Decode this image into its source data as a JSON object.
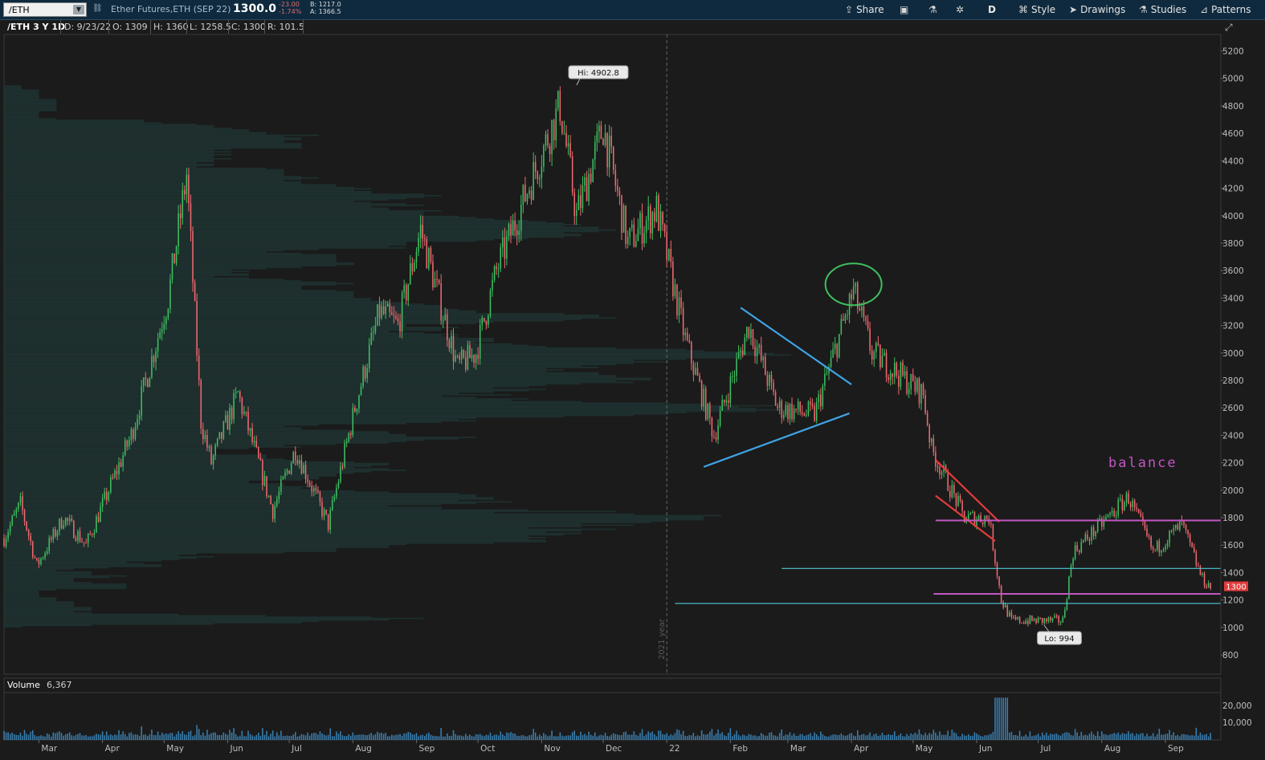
{
  "toolbar": {
    "symbol": "/ETH",
    "description": "Ether Futures,ETH (SEP 22)",
    "last_price": "1300.0",
    "change": "-23.00",
    "change_pct": "-1.74%",
    "bid": "B: 1217.0",
    "ask": "A: 1366.5",
    "share_label": "Share",
    "aggregation_label": "D",
    "style_label": "Style",
    "drawings_label": "Drawings",
    "studies_label": "Studies",
    "patterns_label": "Patterns"
  },
  "info_bar": {
    "title": "/ETH 3 Y 1D",
    "date": "D: 9/23/22",
    "open": "O: 1309",
    "high": "H: 1360",
    "low": "L: 1258.5",
    "close": "C: 1300",
    "range": "R: 101.5"
  },
  "volume_pane": {
    "label": "Volume",
    "value": "6,367",
    "ticks": [
      "20,000",
      "10,000"
    ]
  },
  "chart_data": {
    "type": "candlestick",
    "y_axis": {
      "ticks": [
        5200,
        5000,
        4800,
        4600,
        4400,
        4200,
        4000,
        3800,
        3600,
        3400,
        3200,
        3000,
        2800,
        2600,
        2400,
        2200,
        2000,
        1800,
        1600,
        1400,
        1200,
        1000,
        800
      ],
      "ylim": [
        660,
        5320
      ]
    },
    "x_axis": {
      "labels": [
        "Mar",
        "Apr",
        "May",
        "Jun",
        "Jul",
        "Aug",
        "Sep",
        "Oct",
        "Nov",
        "Dec",
        "22",
        "Feb",
        "Mar",
        "Apr",
        "May",
        "Jun",
        "Jul",
        "Aug",
        "Sep"
      ],
      "dates": [
        "2021-03-01",
        "2021-04-01",
        "2021-05-01",
        "2021-06-01",
        "2021-07-01",
        "2021-08-01",
        "2021-09-01",
        "2021-10-01",
        "2021-11-01",
        "2021-12-01",
        "2022-01-01",
        "2022-02-01",
        "2022-03-01",
        "2022-04-01",
        "2022-05-01",
        "2022-06-01",
        "2022-07-01",
        "2022-08-01",
        "2022-09-01"
      ],
      "range": [
        "2021-02-12",
        "2022-09-28"
      ]
    },
    "price_path": [
      [
        "2021-02-12",
        1650
      ],
      [
        "2021-02-20",
        1900
      ],
      [
        "2021-02-28",
        1450
      ],
      [
        "2021-03-13",
        1800
      ],
      [
        "2021-03-24",
        1600
      ],
      [
        "2021-04-15",
        2400
      ],
      [
        "2021-05-03",
        3400
      ],
      [
        "2021-05-12",
        4300
      ],
      [
        "2021-05-19",
        2500
      ],
      [
        "2021-05-24",
        2200
      ],
      [
        "2021-06-06",
        2700
      ],
      [
        "2021-06-23",
        1850
      ],
      [
        "2021-07-04",
        2300
      ],
      [
        "2021-07-20",
        1750
      ],
      [
        "2021-08-02",
        2600
      ],
      [
        "2021-08-14",
        3300
      ],
      [
        "2021-08-23",
        3200
      ],
      [
        "2021-09-03",
        3900
      ],
      [
        "2021-09-21",
        2900
      ],
      [
        "2021-09-30",
        3000
      ],
      [
        "2021-10-10",
        3600
      ],
      [
        "2021-10-28",
        4300
      ],
      [
        "2021-11-10",
        4800
      ],
      [
        "2021-11-18",
        4000
      ],
      [
        "2021-12-01",
        4650
      ],
      [
        "2021-12-13",
        3800
      ],
      [
        "2021-12-27",
        4050
      ],
      [
        "2022-01-10",
        3100
      ],
      [
        "2022-01-24",
        2400
      ],
      [
        "2022-02-10",
        3200
      ],
      [
        "2022-02-24",
        2600
      ],
      [
        "2022-03-14",
        2550
      ],
      [
        "2022-04-02",
        3450
      ],
      [
        "2022-04-11",
        3000
      ],
      [
        "2022-05-06",
        2700
      ],
      [
        "2022-05-10",
        2300
      ],
      [
        "2022-05-26",
        1800
      ],
      [
        "2022-06-07",
        1800
      ],
      [
        "2022-06-13",
        1200
      ],
      [
        "2022-06-18",
        1050
      ],
      [
        "2022-07-13",
        1050
      ],
      [
        "2022-07-18",
        1550
      ],
      [
        "2022-08-14",
        1950
      ],
      [
        "2022-08-26",
        1550
      ],
      [
        "2022-09-09",
        1750
      ],
      [
        "2022-09-19",
        1350
      ],
      [
        "2022-09-23",
        1300
      ]
    ],
    "annotations": {
      "high_label": "Hi: 4902.8",
      "low_label": "Lo: 994",
      "last_price_tag": "1300",
      "balance_text": "balance",
      "year_marker": "2021 year",
      "trendlines": [
        {
          "name": "triangle-upper",
          "color": "#3fa4e6",
          "from": [
            "2022-02-06",
            3330
          ],
          "to": [
            "2022-04-01",
            2770
          ]
        },
        {
          "name": "triangle-lower",
          "color": "#3fa4e6",
          "from": [
            "2022-01-19",
            2170
          ],
          "to": [
            "2022-03-31",
            2560
          ]
        },
        {
          "name": "flag-upper",
          "color": "#e23b3b",
          "from": [
            "2022-05-12",
            2220
          ],
          "to": [
            "2022-06-12",
            1770
          ]
        },
        {
          "name": "flag-lower",
          "color": "#e23b3b",
          "from": [
            "2022-05-12",
            1960
          ],
          "to": [
            "2022-06-10",
            1630
          ]
        }
      ],
      "horizontal_levels": [
        {
          "name": "balance-upper",
          "color": "#c256c2",
          "price": 1780,
          "from": "2022-05-12"
        },
        {
          "name": "balance-lower",
          "color": "#c256c2",
          "price": 1245,
          "from": "2022-05-11"
        },
        {
          "name": "support-upper",
          "color": "#4ec8d8",
          "price": 1430,
          "from": "2022-02-26"
        },
        {
          "name": "support-lower",
          "color": "#4ec8d8",
          "price": 1175,
          "from": "2022-01-05"
        }
      ],
      "circle": {
        "color": "#3fbf5f",
        "center": [
          "2022-04-02",
          3500
        ]
      }
    },
    "colors": {
      "up": "#3fbf5f",
      "down": "#f0686f",
      "profile": "#1e3432"
    }
  }
}
